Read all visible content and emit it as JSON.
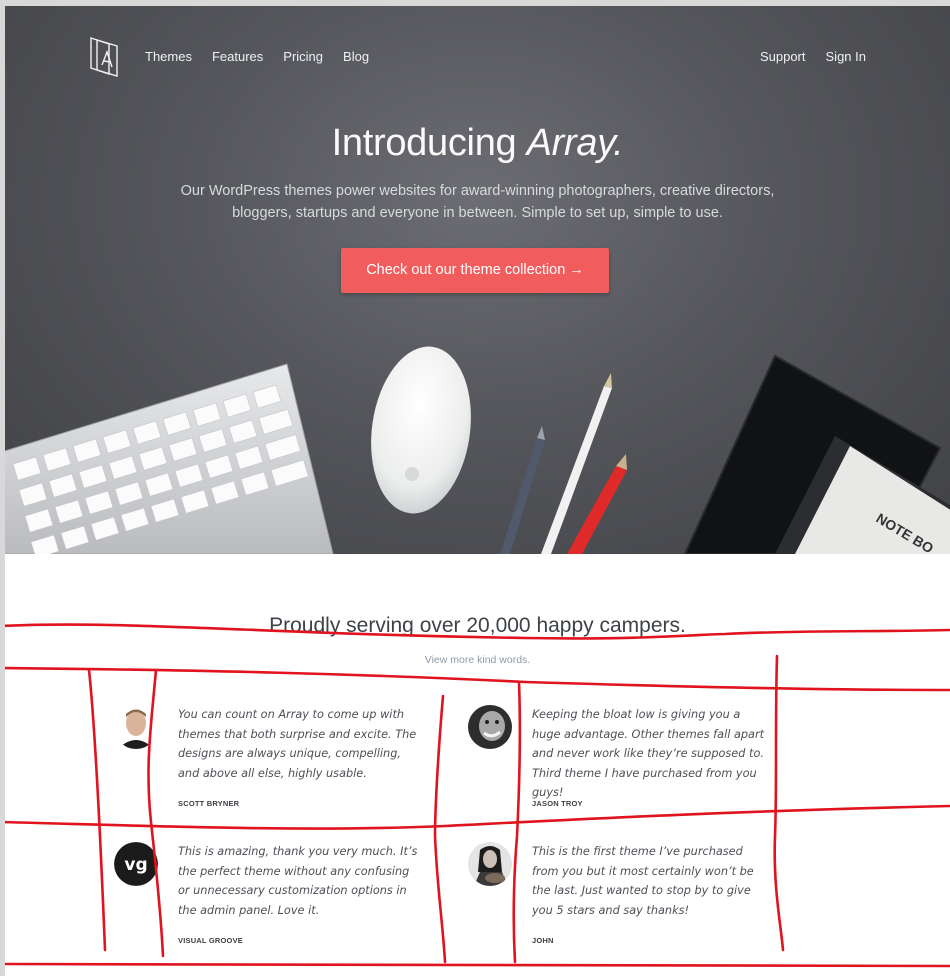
{
  "nav": {
    "links": [
      "Themes",
      "Features",
      "Pricing",
      "Blog"
    ],
    "right": [
      "Support",
      "Sign In"
    ]
  },
  "hero": {
    "title_main": "Introducing ",
    "title_em": "Array.",
    "subtitle": "Our WordPress themes power websites for award-winning photographers, creative directors, bloggers, startups and everyone in between. Simple to set up, simple to use.",
    "cta": "Check out our theme collection →",
    "notebook_label": "NOTE BO"
  },
  "testimonials": {
    "title": "Proudly serving over 20,000 happy campers.",
    "view_more": "View more kind words.",
    "items": [
      {
        "quote": "You can count on Array to come up with themes that both surprise and excite. The designs are always unique, compelling, and above all else, highly usable.",
        "author": "SCOTT BRYNER"
      },
      {
        "quote": "Keeping the bloat low is giving you a huge advantage. Other themes fall apart and never work like they’re supposed to. Third theme I have purchased from you guys!",
        "author": "JASON TROY"
      },
      {
        "quote": "This is amazing, thank you very much. It’s the perfect theme without any confusing or unnecessary customization options in the admin panel. Love it.",
        "author": "VISUAL GROOVE",
        "avatar_text": "vg"
      },
      {
        "quote": "This is the first theme I’ve purchased from you but it most certainly won’t be the last. Just wanted to stop by to give you 5 stars and say thanks!",
        "author": "JOHN"
      }
    ]
  },
  "colors": {
    "cta": "#f15d5d",
    "annotation": "#e0141e",
    "hero_bg": "#55565b"
  }
}
